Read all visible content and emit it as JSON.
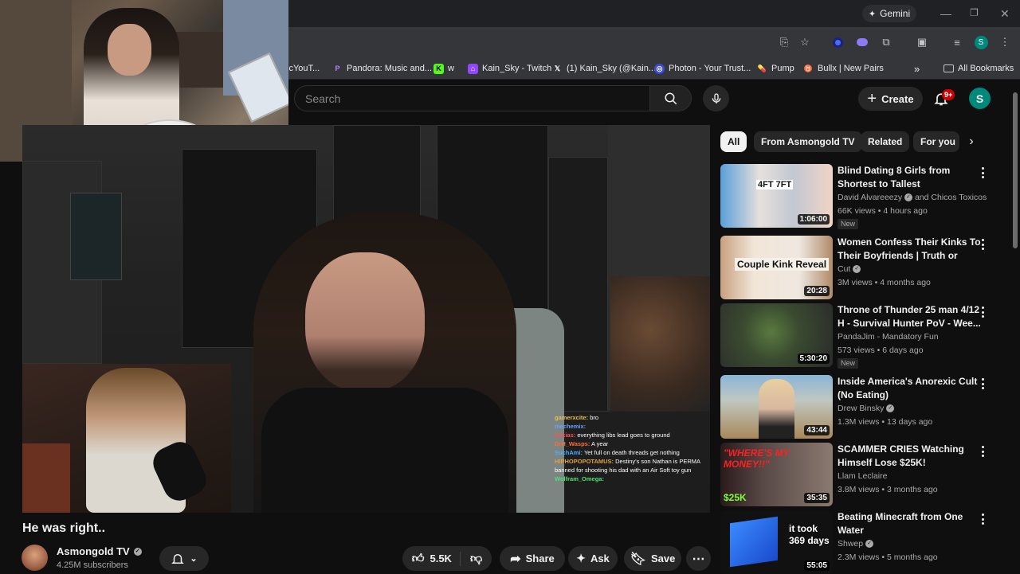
{
  "browser": {
    "gemini_label": "Gemini",
    "bookmarks": [
      {
        "label": "icYouT...",
        "icon": "youtube-icon",
        "color": "#ff0000"
      },
      {
        "label": "Pandora: Music and...",
        "icon": "pandora-icon",
        "color": "#8a3ffc"
      },
      {
        "label": "w",
        "icon": "kick-icon",
        "color": "#53fc18"
      },
      {
        "label": "Kain_Sky - Twitch",
        "icon": "twitch-icon",
        "color": "#9146ff"
      },
      {
        "label": "(1) Kain_Sky (@Kain...",
        "icon": "x-icon",
        "color": "#000000"
      },
      {
        "label": "Photon - Your Trust...",
        "icon": "photon-icon",
        "color": "#5b7bff"
      },
      {
        "label": "Pump",
        "icon": "pump-icon",
        "color": "#86efac"
      },
      {
        "label": "Bullx | New Pairs",
        "icon": "bullx-icon",
        "color": "#22c55e"
      }
    ],
    "all_bookmarks_label": "All Bookmarks",
    "profile_initial": "S"
  },
  "youtube": {
    "search_placeholder": "Search",
    "create_label": "Create",
    "notification_count": "9+",
    "avatar_initial": "S"
  },
  "video": {
    "title": "He was right..",
    "channel": "Asmongold TV",
    "subscribers": "4.25M subscribers",
    "likes": "5.5K",
    "share_label": "Share",
    "ask_label": "Ask",
    "save_label": "Save",
    "chat": [
      {
        "user": "gamerxcite:",
        "msg": "bro",
        "color": "#e0c050"
      },
      {
        "user": "mechemix:",
        "msg": "",
        "color": "#6aa0ff"
      },
      {
        "user": "Zokias:",
        "msg": "everything libs lead goes to ground",
        "color": "#ff5050"
      },
      {
        "user": "DrH_Wasps:",
        "msg": "A year",
        "color": "#ff6a3a"
      },
      {
        "user": "SuchAmi:",
        "msg": "Yet full on death threads get nothing",
        "color": "#4ab0ff"
      },
      {
        "user": "HIPHOPOPOTAMUS:",
        "msg": "Destiny's son Nathan is PERMA",
        "color": "#e0a040"
      },
      {
        "user": "",
        "msg": "banned for shooting his dad with an Air Soft toy gun",
        "color": "#ffffff"
      },
      {
        "user": "Wolfram_Omega:",
        "msg": "",
        "color": "#50e070"
      }
    ]
  },
  "chips": [
    {
      "label": "All",
      "active": true
    },
    {
      "label": "From Asmongold TV",
      "active": false
    },
    {
      "label": "Related",
      "active": false
    },
    {
      "label": "For you",
      "active": false
    }
  ],
  "recommendations": [
    {
      "title": "Blind Dating 8 Girls from Shortest to Tallest",
      "channel": "David Alvareeezy",
      "collab": "and Chicos Toxicos",
      "meta": "66K views • 4 hours ago",
      "duration": "1:06:00",
      "is_new": true,
      "new_label": "New",
      "thumb_text": "4FT 7FT"
    },
    {
      "title": "Women Confess Their Kinks To Their Boyfriends | Truth or Drin...",
      "channel": "Cut",
      "meta": "3M views • 4 months ago",
      "duration": "20:28",
      "thumb_text": "Couple Kink Reveal"
    },
    {
      "title": "Throne of Thunder 25 man 4/12 H - Survival Hunter PoV - Wee...",
      "channel": "PandaJim - Mandatory Fun",
      "meta": "573 views • 6 days ago",
      "duration": "5:30:20",
      "is_new": true,
      "new_label": "New"
    },
    {
      "title": "Inside America's Anorexic Cult (No Eating)",
      "channel": "Drew Binsky",
      "meta": "1.3M views • 13 days ago",
      "duration": "43:44"
    },
    {
      "title": "SCAMMER CRIES Watching Himself Lose $25K!",
      "channel": "Llam Leclaire",
      "meta": "3.8M views • 3 months ago",
      "duration": "35:35",
      "thumb_text": "$25K"
    },
    {
      "title": "Beating Minecraft from One Water",
      "channel": "Shwep",
      "meta": "2.3M views • 5 months ago",
      "duration": "55:05",
      "thumb_text": "it took 369 days"
    }
  ]
}
